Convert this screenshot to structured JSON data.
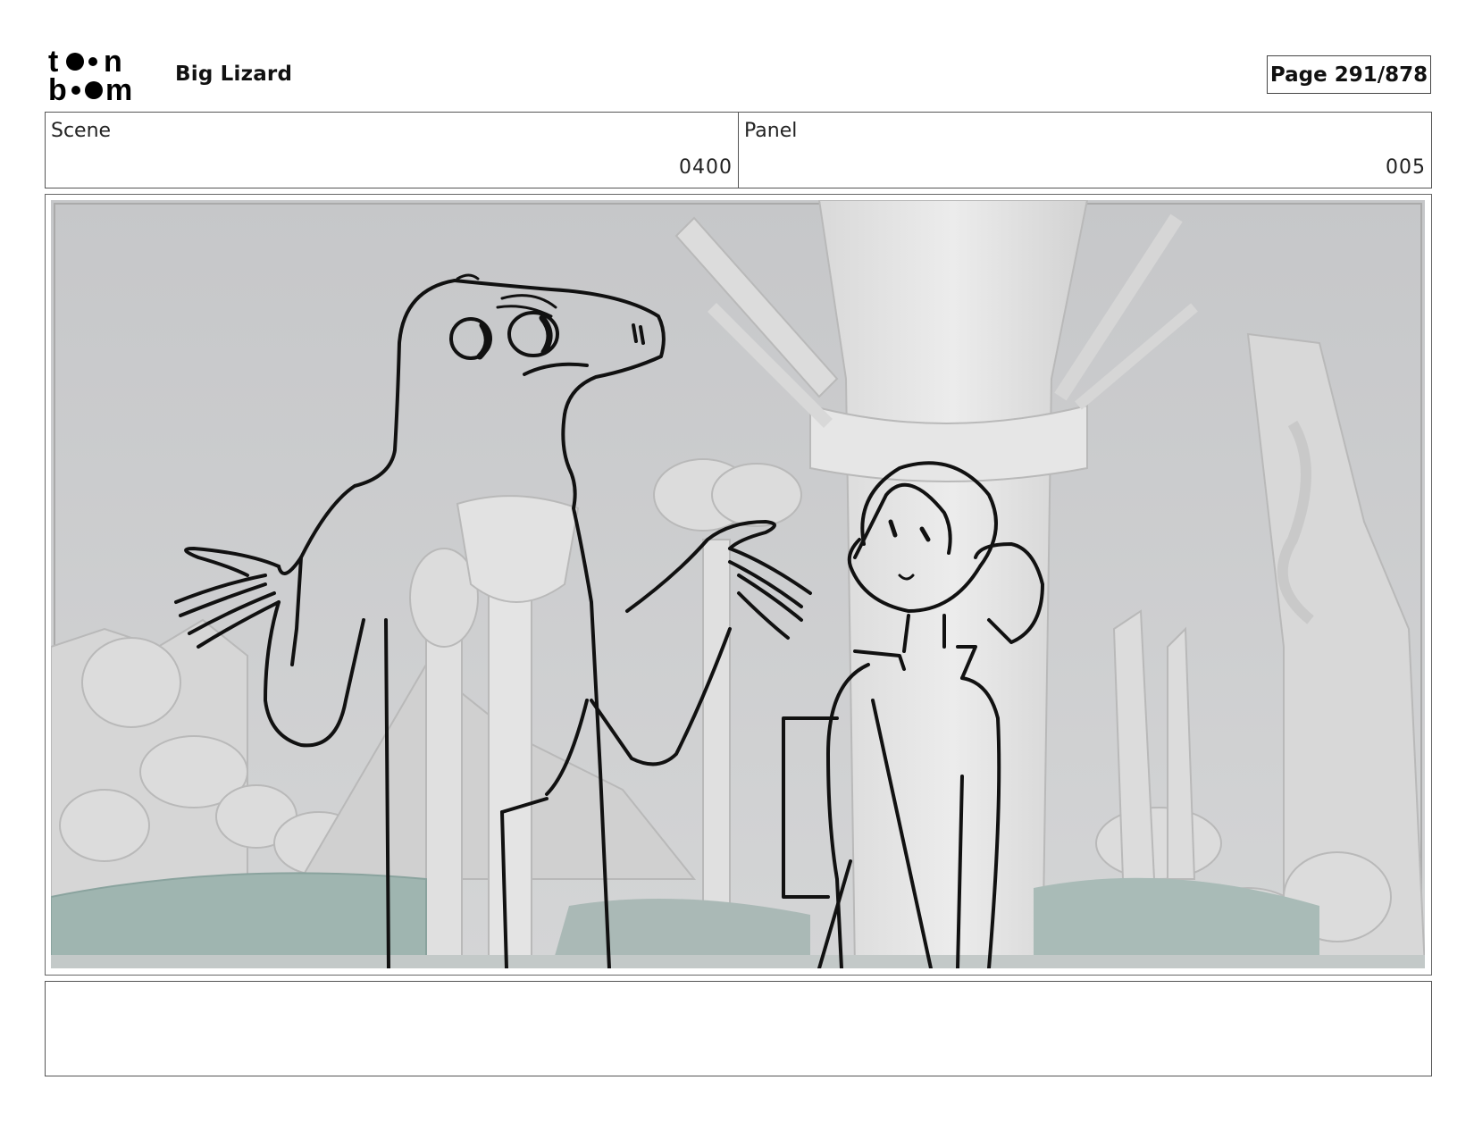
{
  "header": {
    "logo_text": [
      "to n",
      "b om"
    ],
    "project_title": "Big Lizard",
    "page_label": "Page 291/878"
  },
  "info": {
    "scene_label": "Scene",
    "scene_value": "0400",
    "panel_label": "Panel",
    "panel_value": "005"
  },
  "panel": {
    "description_colors": {
      "background": "#c8c9cb",
      "ground": "#9fb5b0",
      "line": "#111111"
    }
  },
  "notes": {
    "text": ""
  }
}
